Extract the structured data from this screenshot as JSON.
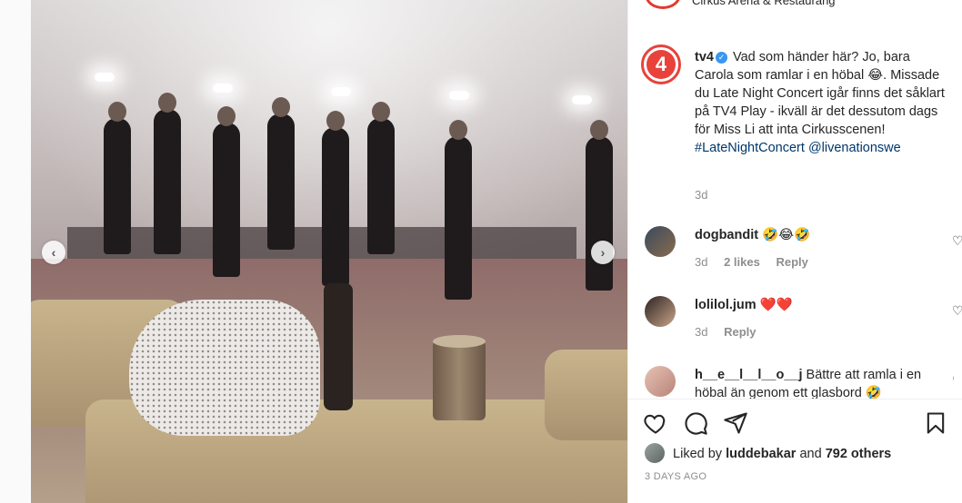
{
  "header": {
    "location": "Cirkus Arena & Restaurang"
  },
  "post": {
    "username": "tv4",
    "logo_text": "4",
    "caption_text": "Vad som händer här? Jo, bara Carola som ramlar i en höbal 😂. Missade du Late Night Concert igår finns det såklart på TV4 Play - ikväll är det dessutom dags för Miss Li att inta Cirkusscenen! ",
    "hashtag": "#LateNightConcert",
    "mention": "@livenationswe",
    "age": "3d"
  },
  "comments": [
    {
      "username": "dogbandit",
      "text": "🤣😂🤣",
      "time": "3d",
      "likes": "2 likes",
      "reply": "Reply"
    },
    {
      "username": "lolilol.jum",
      "text": "❤️❤️",
      "time": "3d",
      "reply": "Reply"
    },
    {
      "username": "h__e__l__l__o__j",
      "text": "Bättre att ramla i en höbal än genom ett glasbord 🤣"
    }
  ],
  "likes": {
    "prefix": "Liked by",
    "user": "luddebakar",
    "middle": "and",
    "others": "792 others"
  },
  "date": "3 DAYS AGO",
  "colors": {
    "brand": "#e8423a",
    "verified": "#3897f0",
    "link": "#00376b",
    "heart": "#ed4956"
  },
  "icons": [
    "heart-icon",
    "comment-icon",
    "share-icon",
    "bookmark-icon",
    "chevron-left-icon",
    "chevron-right-icon",
    "verified-icon"
  ]
}
